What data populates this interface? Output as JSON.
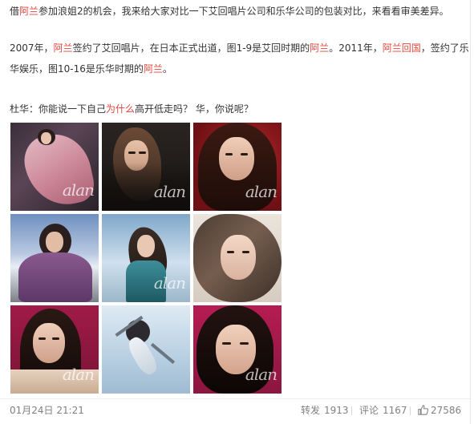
{
  "post": {
    "line1": {
      "s1": "借",
      "h1": "阿兰",
      "s2": "参加浪姐2的机会，我来给大家对比一下艾回唱片公司和乐华公司的包装对比，来看看审美差异。"
    },
    "line2a": {
      "s1": "2007年，",
      "h1": "阿兰",
      "s2": "签约了艾回唱片，在日本正式出道，图1-9是艾回时期的",
      "h2": "阿兰",
      "s3": "。2011年，",
      "h3": "阿兰回国",
      "s4": "，签约了乐"
    },
    "line2b": {
      "s1": "华娱乐，图10-16是乐华时期的",
      "h1": "阿兰",
      "s2": "。"
    },
    "line3": {
      "s1": "杜华：你能说一下自己",
      "h1": "为什么",
      "s2": "高开低走吗？ 华，你说呢？"
    }
  },
  "images": [
    {
      "name": "photo-1",
      "watermark": "alan"
    },
    {
      "name": "photo-2",
      "watermark": "alan"
    },
    {
      "name": "photo-3",
      "watermark": "alan"
    },
    {
      "name": "photo-4",
      "watermark": ""
    },
    {
      "name": "photo-5",
      "watermark": "alan"
    },
    {
      "name": "photo-6",
      "watermark": ""
    },
    {
      "name": "photo-7",
      "watermark": "alan"
    },
    {
      "name": "photo-8",
      "watermark": ""
    },
    {
      "name": "photo-9",
      "watermark": "alan"
    }
  ],
  "footer": {
    "date": "01月24日 21:21",
    "repost_label": "转发",
    "repost_count": "1913",
    "comment_label": "评论",
    "comment_count": "1167",
    "like_count": "27586",
    "like_icon": "thumbs-up-icon"
  },
  "colors": {
    "highlight": "#e2453b",
    "text": "#333333",
    "muted": "#808080"
  }
}
